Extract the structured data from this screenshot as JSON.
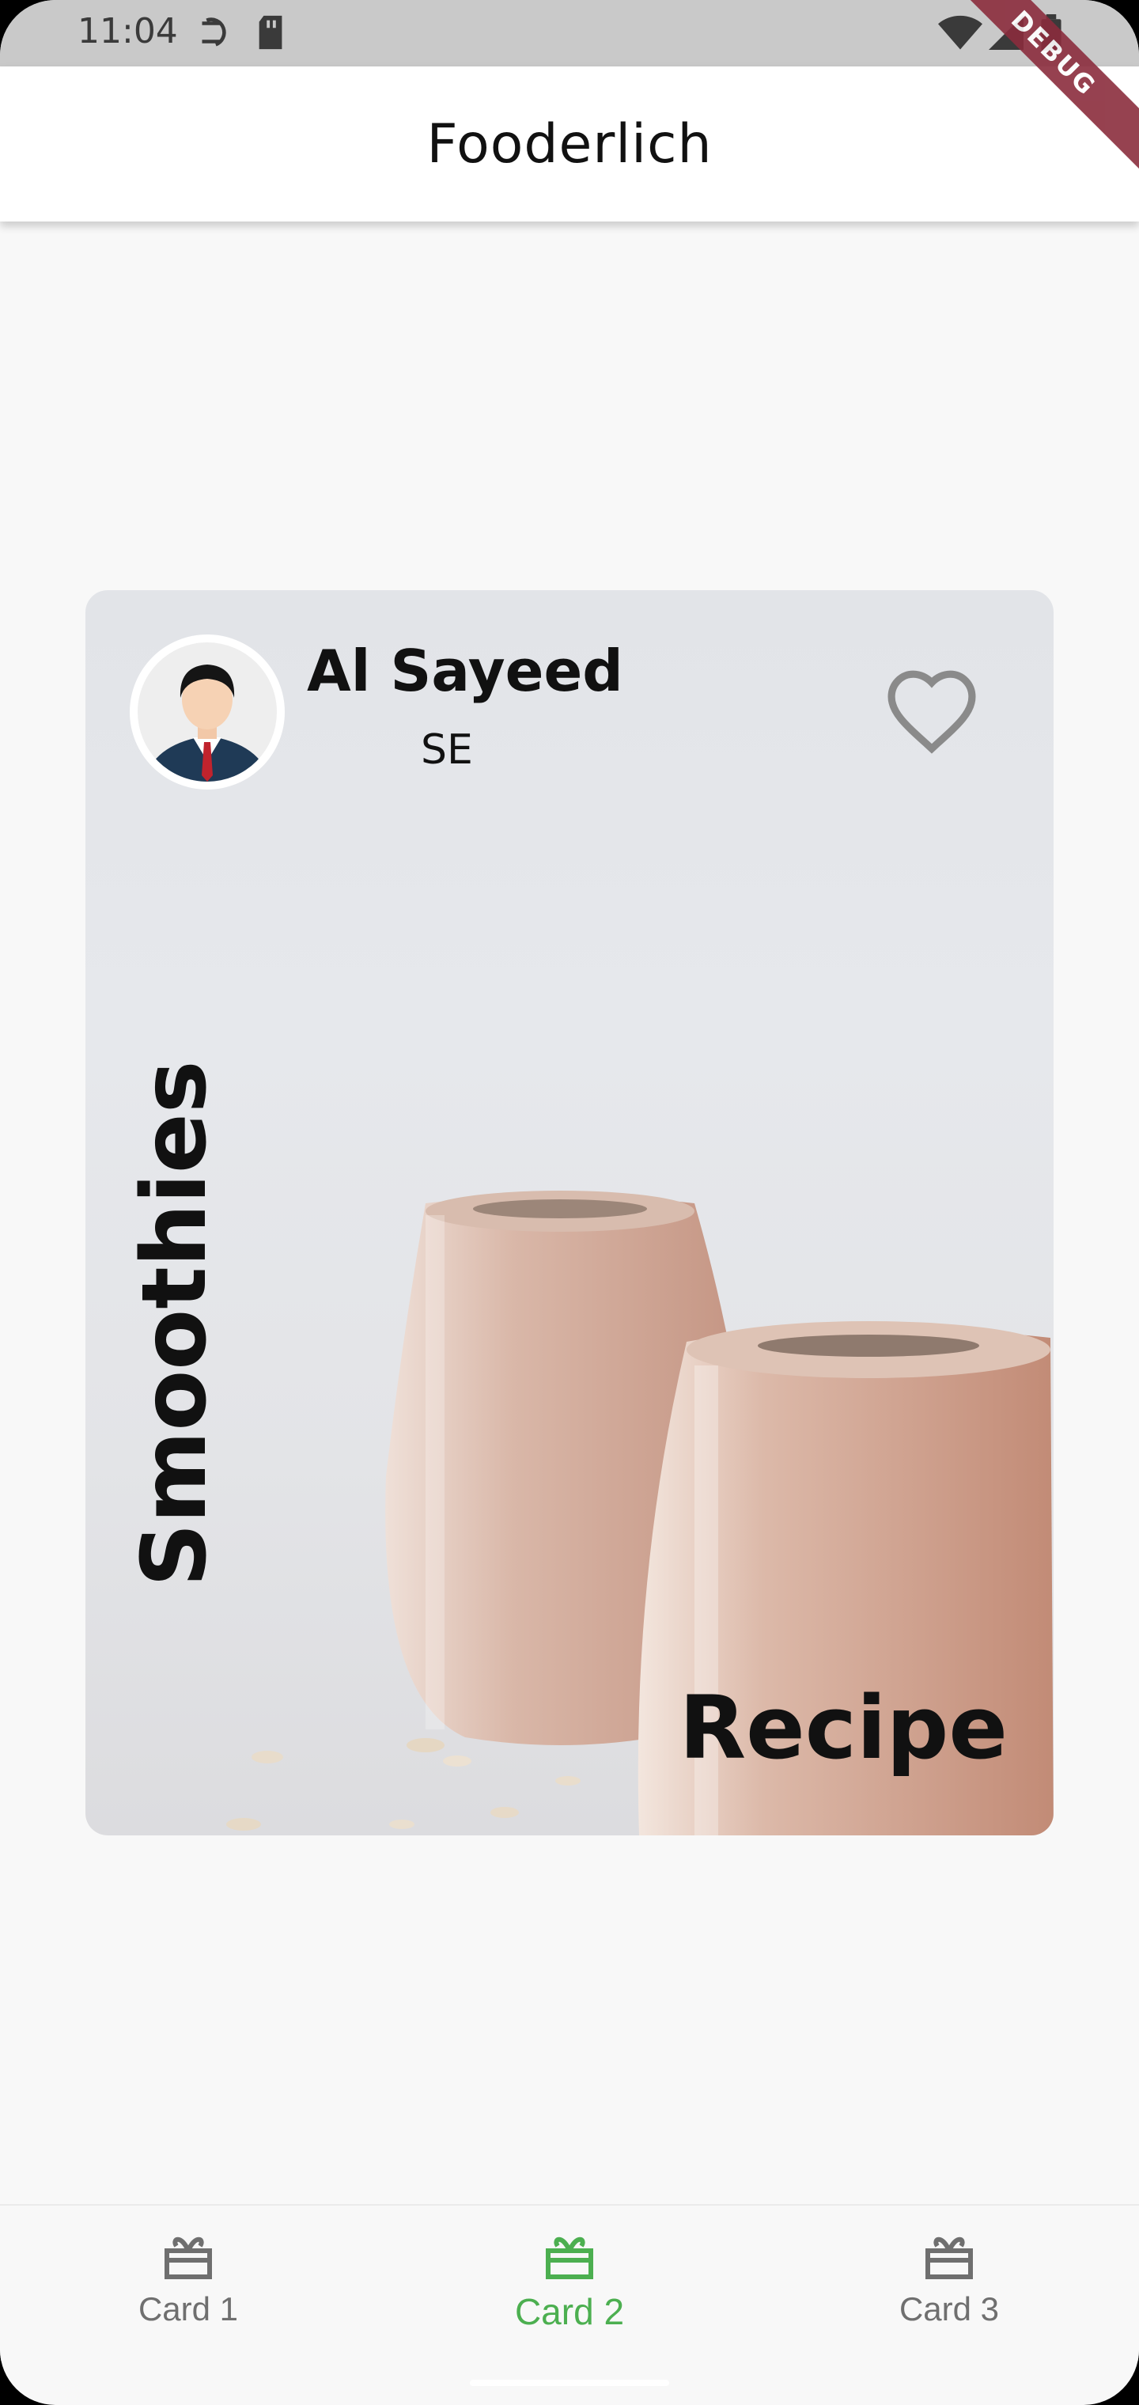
{
  "status_bar": {
    "time": "11:04",
    "icons": [
      "sync-icon",
      "sd-card-icon",
      "wifi-icon",
      "signal-icon",
      "battery-icon"
    ]
  },
  "debug_banner": "DEBUG",
  "app_bar": {
    "title": "Fooderlich"
  },
  "card": {
    "author_name": "Al Sayeed",
    "author_role": "SE",
    "avatar_icon": "avatar-icon",
    "favorite_icon": "heart-outline-icon",
    "vertical_title": "Smoothies",
    "recipe_label": "Recipe"
  },
  "bottom_nav": {
    "items": [
      {
        "label": "Card 1",
        "icon": "card-icon",
        "active": false
      },
      {
        "label": "Card 2",
        "icon": "card-icon",
        "active": true
      },
      {
        "label": "Card 3",
        "icon": "card-icon",
        "active": false
      }
    ]
  },
  "colors": {
    "accent": "#4caf50",
    "debug": "#8b2d3d"
  }
}
